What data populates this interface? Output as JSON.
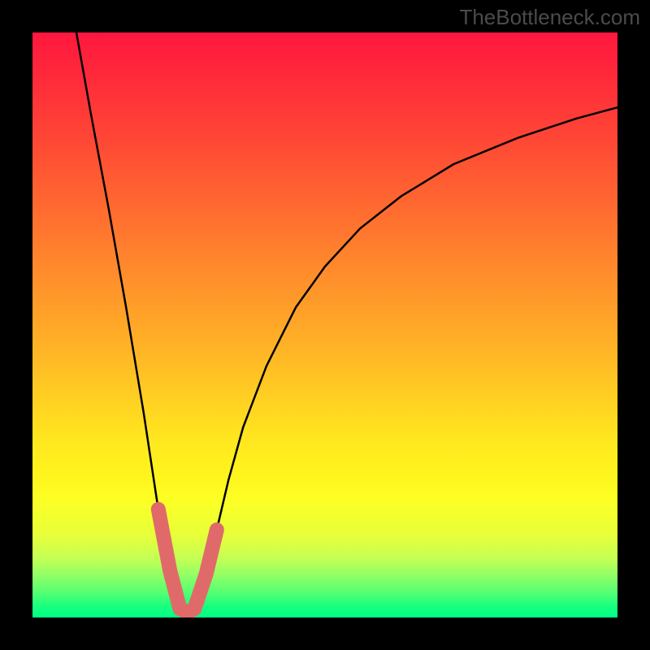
{
  "watermark": "TheBottleneck.com",
  "chart_data": {
    "type": "line",
    "title": "",
    "xlabel": "",
    "ylabel": "",
    "xlim": [
      0,
      1
    ],
    "ylim": [
      0,
      1
    ],
    "series": [
      {
        "name": "curve",
        "x": [
          0.075,
          0.1,
          0.13,
          0.16,
          0.19,
          0.215,
          0.235,
          0.252,
          0.265,
          0.277,
          0.297,
          0.315,
          0.335,
          0.36,
          0.4,
          0.45,
          0.5,
          0.56,
          0.63,
          0.72,
          0.83,
          0.93,
          1.0
        ],
        "y": [
          1.0,
          0.86,
          0.7,
          0.53,
          0.35,
          0.185,
          0.08,
          0.015,
          0.008,
          0.015,
          0.075,
          0.15,
          0.235,
          0.325,
          0.43,
          0.53,
          0.6,
          0.665,
          0.72,
          0.775,
          0.82,
          0.853,
          0.872
        ]
      },
      {
        "name": "highlight",
        "x": [
          0.215,
          0.235,
          0.252,
          0.265,
          0.277,
          0.297,
          0.315
        ],
        "y": [
          0.185,
          0.08,
          0.015,
          0.008,
          0.015,
          0.075,
          0.15
        ]
      }
    ],
    "colors": {
      "curve": "#000000",
      "highlight": "#e06a6a",
      "background_top": "#ff173e",
      "background_bottom": "#00ff86",
      "frame": "#000000"
    }
  }
}
